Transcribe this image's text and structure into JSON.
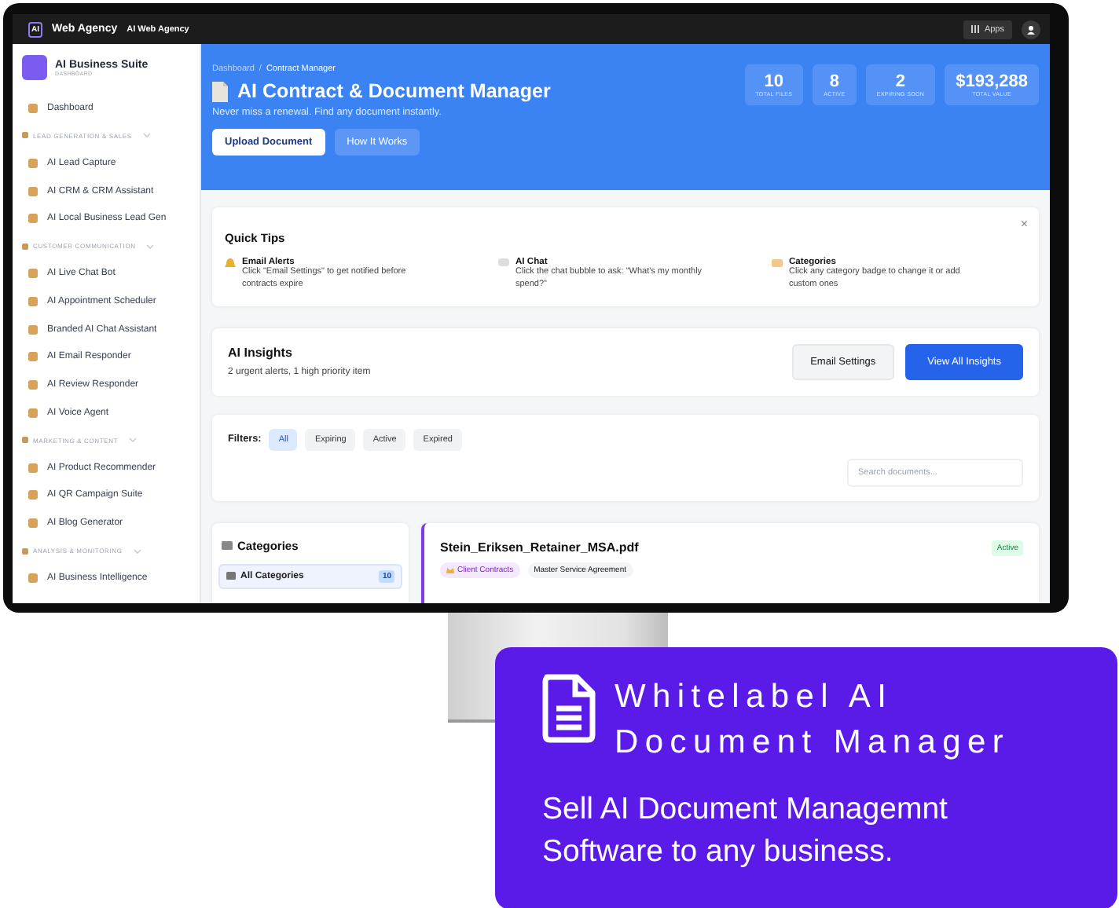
{
  "topbar": {
    "logo_mark": "AI",
    "brand": "Web Agency",
    "workspace": "AI Web Agency",
    "apps_button": "Apps"
  },
  "sidebar": {
    "title": "AI Business Suite",
    "subtitle": "DASHBOARD",
    "items": [
      {
        "kind": "link",
        "label": "Dashboard",
        "selected": false
      },
      {
        "kind": "section",
        "label": "LEAD GENERATION & SALES",
        "expanded": true
      },
      {
        "kind": "link",
        "label": "AI Lead Capture",
        "selected": false
      },
      {
        "kind": "link",
        "label": "AI CRM & CRM Assistant",
        "selected": false
      },
      {
        "kind": "link",
        "label": "AI Local Business Lead Gen",
        "selected": false
      },
      {
        "kind": "section",
        "label": "CUSTOMER COMMUNICATION",
        "expanded": true
      },
      {
        "kind": "link",
        "label": "AI Live Chat Bot",
        "selected": false
      },
      {
        "kind": "link",
        "label": "AI Appointment Scheduler",
        "selected": false
      },
      {
        "kind": "link",
        "label": "Branded AI Chat Assistant",
        "selected": false
      },
      {
        "kind": "link",
        "label": "AI Email Responder",
        "selected": false
      },
      {
        "kind": "link",
        "label": "AI Review Responder",
        "selected": false
      },
      {
        "kind": "link",
        "label": "AI Voice Agent",
        "selected": false
      },
      {
        "kind": "section",
        "label": "MARKETING & CONTENT",
        "expanded": true
      },
      {
        "kind": "link",
        "label": "AI Product Recommender",
        "selected": false
      },
      {
        "kind": "link",
        "label": "AI QR Campaign Suite",
        "selected": false
      },
      {
        "kind": "link",
        "label": "AI Blog Generator",
        "selected": false
      },
      {
        "kind": "section",
        "label": "ANALYSIS & MONITORING",
        "expanded": true
      },
      {
        "kind": "link",
        "label": "AI Business Intelligence",
        "selected": false
      }
    ]
  },
  "header": {
    "breadcrumb": [
      "Dashboard",
      "Contract Manager"
    ],
    "separator": "/",
    "title": "AI Contract & Document Manager",
    "subtitle": "Never miss a renewal. Find any document instantly.",
    "buttons": [
      {
        "label": "Upload Document",
        "kind": "primary"
      },
      {
        "label": "How It Works",
        "kind": "secondary"
      }
    ],
    "stats": [
      {
        "value": "10",
        "label": "TOTAL FILES"
      },
      {
        "value": "8",
        "label": "ACTIVE"
      },
      {
        "value": "2",
        "label": "EXPIRING SOON"
      },
      {
        "value": "$193,288",
        "label": "TOTAL VALUE"
      }
    ]
  },
  "quick_tips": {
    "title": "Quick Tips",
    "close": "×",
    "tips": [
      {
        "title": "Email Alerts",
        "text": "Click \"Email Settings\" to get notified before contracts expire"
      },
      {
        "title": "AI Chat",
        "text": "Click the chat bubble to ask: \"What's my monthly spend?\""
      },
      {
        "title": "Categories",
        "text": "Click any category badge to change it or add custom ones"
      }
    ]
  },
  "insights": {
    "title": "AI Insights",
    "summary": "2 urgent alerts, 1 high priority item",
    "buttons": [
      {
        "label": "Email Settings",
        "kind": "secondary"
      },
      {
        "label": "View All Insights",
        "kind": "primary"
      }
    ]
  },
  "filters": {
    "label": "Filters:",
    "chips": [
      {
        "label": "All",
        "selected": true
      },
      {
        "label": "Expiring",
        "selected": false
      },
      {
        "label": "Active",
        "selected": false
      },
      {
        "label": "Expired",
        "selected": false
      }
    ],
    "search": {
      "placeholder": "Search documents..."
    }
  },
  "categories": {
    "title": "Categories",
    "items": [
      {
        "label": "All Categories",
        "count": "10",
        "selected": true
      }
    ]
  },
  "document": {
    "name": "Stein_Eriksen_Retainer_MSA.pdf",
    "status": "Active",
    "tags": [
      {
        "label": "Client Contracts",
        "kind": "category"
      },
      {
        "label": "Master Service Agreement",
        "kind": "type"
      }
    ]
  },
  "promo": {
    "title": "Whitelabel AI Document Manager",
    "text": "Sell AI Document Managemnt Software to any business."
  }
}
